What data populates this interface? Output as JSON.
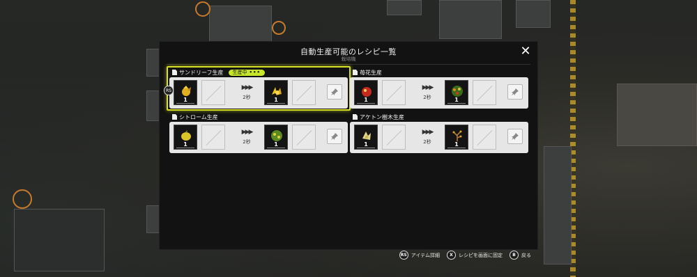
{
  "modal": {
    "title": "自動生産可能のレシピ一覧",
    "subtitle": "栽培機",
    "close_icon": "close-icon"
  },
  "recipes": [
    {
      "name": "サンドリーフ生産",
      "status": "生産中",
      "status_dots": "•••",
      "selected": true,
      "input_qty": "1",
      "time": "2秒",
      "output_qty": "1",
      "input_icon": "sandleaf-seed-icon",
      "output_icon": "sandleaf-icon"
    },
    {
      "name": "苺花生産",
      "status": "",
      "selected": false,
      "input_qty": "1",
      "time": "2秒",
      "output_qty": "1",
      "input_icon": "berry-seed-icon",
      "output_icon": "berry-plant-icon"
    },
    {
      "name": "シトローム生産",
      "status": "",
      "selected": false,
      "input_qty": "1",
      "time": "2秒",
      "output_qty": "1",
      "input_icon": "citrome-seed-icon",
      "output_icon": "citrome-plant-icon"
    },
    {
      "name": "アケトン樹木生産",
      "status": "",
      "selected": false,
      "input_qty": "1",
      "time": "2秒",
      "output_qty": "1",
      "input_icon": "aketon-seed-icon",
      "output_icon": "aketon-tree-icon"
    }
  ],
  "hints": [
    {
      "button": "RS",
      "label": "アイテム詳細"
    },
    {
      "button": "X",
      "label": "レシピを画面に固定"
    },
    {
      "button": "B",
      "label": "戻る"
    }
  ],
  "input_badge": "RS",
  "arrow_glyph": "▶▶▶",
  "colors": {
    "highlight": "#d8e026",
    "badge": "#c6e62b",
    "card_bg": "#e6e6e6",
    "modal_bg": "#111211"
  }
}
